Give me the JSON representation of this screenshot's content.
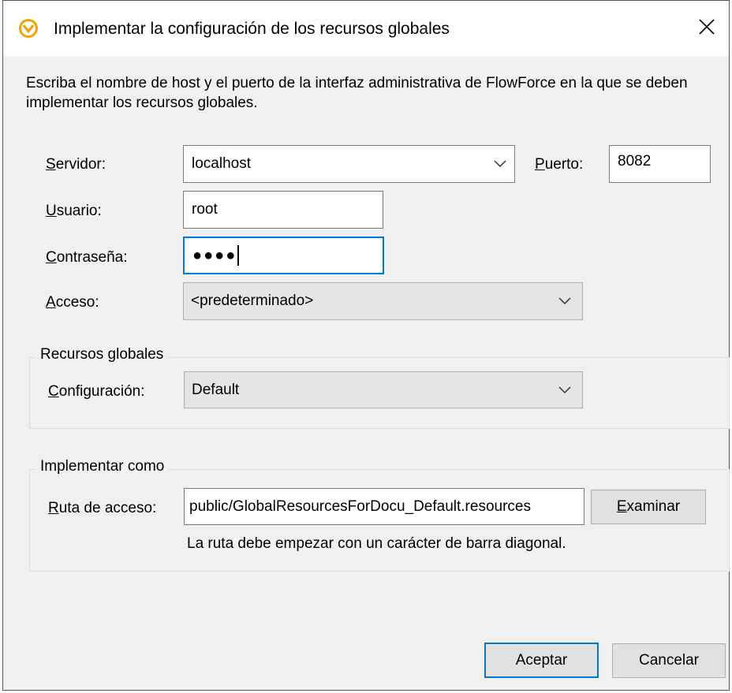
{
  "dialog": {
    "title": "Implementar la configuración de los recursos globales",
    "intro": "Escriba el nombre de host y el puerto de la interfaz administrativa de FlowForce en la que se deben implementar los recursos globales."
  },
  "server": {
    "label_first": "S",
    "label_rest": "ervidor:",
    "value": "localhost"
  },
  "port": {
    "label_first": "P",
    "label_rest": "uerto:",
    "value": "8082"
  },
  "user": {
    "label_first": "U",
    "label_rest": "suario:",
    "value": "root"
  },
  "password": {
    "label_first": "C",
    "label_rest": "ontraseña:",
    "value": "●●●●"
  },
  "access": {
    "label_first": "A",
    "label_rest": "cceso:",
    "value": "<predeterminado>"
  },
  "global_resources": {
    "group_title": "Recursos globales",
    "config_label_first": "C",
    "config_label_rest": "onfiguración:",
    "config_value": "Default"
  },
  "deploy_as": {
    "group_title": "Implementar como",
    "path_label_first": "R",
    "path_label_rest": "uta de acceso:",
    "path_value": "public/GlobalResourcesForDocu_Default.resources",
    "browse_first": "E",
    "browse_rest": "xaminar",
    "hint": "La ruta debe empezar con un carácter de barra diagonal."
  },
  "buttons": {
    "ok": "Aceptar",
    "cancel": "Cancelar"
  },
  "icons": {
    "app": "altova-app-icon",
    "close": "close-icon",
    "dropdown": "chevron-down-icon"
  },
  "colors": {
    "focus": "#0078d7",
    "app_icon": "#f2a300"
  }
}
